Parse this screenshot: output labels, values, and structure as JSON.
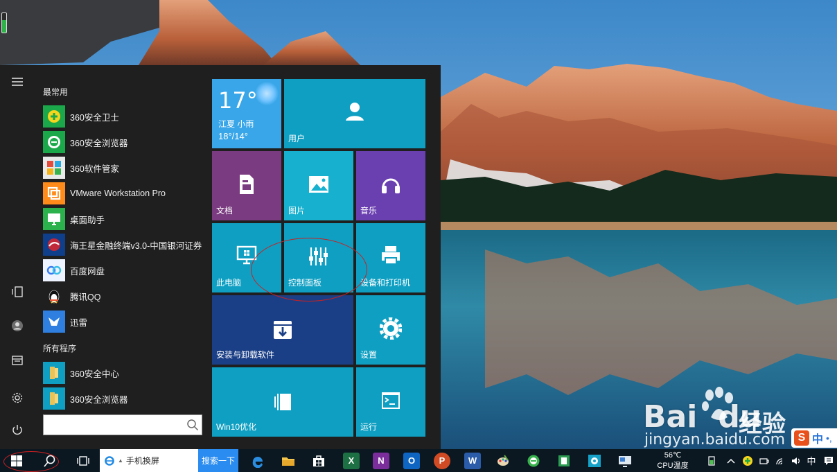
{
  "start_menu": {
    "most_used_label": "最常用",
    "all_programs_label": "所有程序",
    "most_used": [
      {
        "label": "360安全卫士",
        "icon": "360-safeguard-icon",
        "color": "#1aa84a"
      },
      {
        "label": "360安全浏览器",
        "icon": "360-browser-icon",
        "color": "#1aa84a"
      },
      {
        "label": "360软件管家",
        "icon": "360-software-manager-icon",
        "color": "#e24c3c"
      },
      {
        "label": "VMware Workstation Pro",
        "icon": "vmware-icon",
        "color": "#ff8c1a"
      },
      {
        "label": "桌面助手",
        "icon": "desktop-assistant-icon",
        "color": "#2bb24c"
      },
      {
        "label": "海王星金融终端v3.0-中国银河证券",
        "icon": "neptune-finance-icon",
        "color": "#c0283a"
      },
      {
        "label": "百度网盘",
        "icon": "baidu-netdisk-icon",
        "color": "#3a7cf0"
      },
      {
        "label": "腾讯QQ",
        "icon": "qq-penguin-icon",
        "color": "#1e1e1e"
      },
      {
        "label": "迅雷",
        "icon": "xunlei-bird-icon",
        "color": "#2f7fe0"
      }
    ],
    "all_programs": [
      {
        "label": "360安全中心",
        "icon": "folder-icon",
        "color": "#e8c35a"
      },
      {
        "label": "360安全浏览器",
        "icon": "folder-icon",
        "color": "#e8c35a"
      }
    ],
    "tiles": {
      "weather": {
        "temp": "17°",
        "location": "江夏  小雨",
        "range": "18°/14°"
      },
      "user": "用户",
      "documents": "文档",
      "pictures": "图片",
      "music": "音乐",
      "this_pc": "此电脑",
      "control_panel": "控制面板",
      "devices_printers": "设备和打印机",
      "install_uninstall": "安装与卸载软件",
      "settings": "设置",
      "win10_optimize": "Win10优化",
      "run": "运行"
    },
    "colors": {
      "tile_teal": "#0f9fc2",
      "tile_purple": "#7a3b80",
      "tile_violet": "#6a3fb0",
      "tile_navy": "#1b3f86",
      "tile_weather": "#38a6e8"
    }
  },
  "taskbar": {
    "browser_search_text": "手机换屏",
    "browser_search_button": "搜索一下",
    "cpu_temp_value": "56℃",
    "cpu_temp_label": "CPU温度",
    "ime_lang": "中",
    "notification_lang": "中"
  },
  "watermark": {
    "logo": "Bai",
    "logo_suffix": "du",
    "product": "经验",
    "url": "jingyan.baidu.com"
  }
}
